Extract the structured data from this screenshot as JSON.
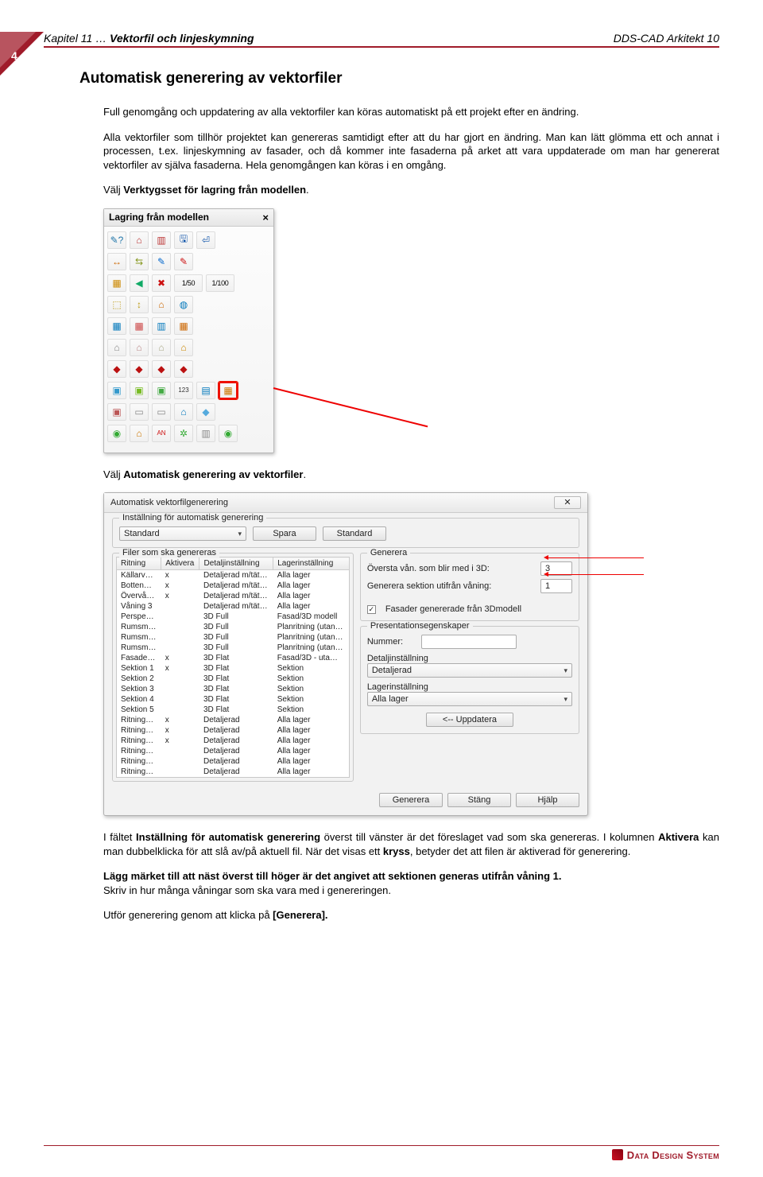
{
  "page_number": "4",
  "header": {
    "chapter_prefix": "Kapitel 11 …",
    "chapter_title": "Vektorfil och linjeskymning",
    "product": "DDS-CAD Arkitekt 10"
  },
  "heading": "Automatisk generering av vektorfiler",
  "para1": "Full genomgång och uppdatering av alla vektorfiler kan köras automatiskt på ett projekt efter en ändring.",
  "para2": "Alla vektorfiler som tillhör projektet kan genereras samtidigt efter att du har gjort en ändring. Man kan lätt glömma ett och annat i processen, t.ex. linjeskymning av fasader, och då kommer inte fasaderna på arket att vara uppdaterade om man har genererat vektorfiler av själva fasaderna. Hela genomgången kan köras i en omgång.",
  "para3_a": "Välj ",
  "para3_b": "Verktygsset för lagring från modellen",
  "para3_c": ".",
  "palette": {
    "title": "Lagring från modellen",
    "scale_a": "1/50",
    "scale_b": "1/100"
  },
  "para4_a": "Välj ",
  "para4_b": "Automatisk generering av vektorfiler",
  "para4_c": ".",
  "dialog": {
    "title": "Automatisk vektorfilgenerering",
    "group1_legend": "Inställning för automatisk generering",
    "preset": "Standard",
    "btn_save": "Spara",
    "btn_standard": "Standard",
    "group2_legend": "Filer som ska genereras",
    "cols": {
      "c1": "Ritning",
      "c2": "Aktivera",
      "c3": "Detaljinställning",
      "c4": "Lagerinställning"
    },
    "rows": [
      {
        "r": "Källarv…",
        "a": "x",
        "d": "Detaljerad m/tät…",
        "l": "Alla lager"
      },
      {
        "r": "Botten…",
        "a": "x",
        "d": "Detaljerad m/tät…",
        "l": "Alla lager"
      },
      {
        "r": "Övervå…",
        "a": "x",
        "d": "Detaljerad m/tät…",
        "l": "Alla lager"
      },
      {
        "r": "Våning 3",
        "a": "",
        "d": "Detaljerad m/tät…",
        "l": "Alla lager"
      },
      {
        "r": "Perspe…",
        "a": "",
        "d": "3D Full",
        "l": "Fasad/3D modell"
      },
      {
        "r": "Rumsm…",
        "a": "",
        "d": "3D Full",
        "l": "Planritning (utan…"
      },
      {
        "r": "Rumsm…",
        "a": "",
        "d": "3D Full",
        "l": "Planritning (utan…"
      },
      {
        "r": "Rumsm…",
        "a": "",
        "d": "3D Full",
        "l": "Planritning (utan…"
      },
      {
        "r": "Fasade…",
        "a": "x",
        "d": "3D Flat",
        "l": "Fasad/3D - uta…"
      },
      {
        "r": "Sektion 1",
        "a": "x",
        "d": "3D Flat",
        "l": "Sektion"
      },
      {
        "r": "Sektion 2",
        "a": "",
        "d": "3D Flat",
        "l": "Sektion"
      },
      {
        "r": "Sektion 3",
        "a": "",
        "d": "3D Flat",
        "l": "Sektion"
      },
      {
        "r": "Sektion 4",
        "a": "",
        "d": "3D Flat",
        "l": "Sektion"
      },
      {
        "r": "Sektion 5",
        "a": "",
        "d": "3D Flat",
        "l": "Sektion"
      },
      {
        "r": "Ritning…",
        "a": "x",
        "d": "Detaljerad",
        "l": "Alla lager"
      },
      {
        "r": "Ritning…",
        "a": "x",
        "d": "Detaljerad",
        "l": "Alla lager"
      },
      {
        "r": "Ritning…",
        "a": "x",
        "d": "Detaljerad",
        "l": "Alla lager"
      },
      {
        "r": "Ritning…",
        "a": "",
        "d": "Detaljerad",
        "l": "Alla lager"
      },
      {
        "r": "Ritning…",
        "a": "",
        "d": "Detaljerad",
        "l": "Alla lager"
      },
      {
        "r": "Ritning…",
        "a": "",
        "d": "Detaljerad",
        "l": "Alla lager"
      }
    ],
    "gen_legend": "Generera",
    "top_floor_label": "Översta vån. som blir med i 3D:",
    "top_floor_value": "3",
    "section_label": "Generera sektion utifrån våning:",
    "section_value": "1",
    "fasader_chk": "Fasader genererade från 3Dmodell",
    "pres_legend": "Presentationsegenskaper",
    "nummer_label": "Nummer:",
    "detalj_label": "Detaljinställning",
    "detalj_value": "Detaljerad",
    "lager_label": "Lagerinställning",
    "lager_value": "Alla lager",
    "btn_update": "<-- Uppdatera",
    "btn_generate": "Generera",
    "btn_close": "Stäng",
    "btn_help": "Hjälp"
  },
  "para5_a": "I fältet ",
  "para5_b": "Inställning för automatisk generering",
  "para5_c": " överst till vänster är det föreslaget vad som ska genereras. I kolumnen ",
  "para5_d": "Aktivera",
  "para5_e": " kan man dubbelklicka för att slå av/på aktuell fil. När det visas ett ",
  "para5_f": "kryss",
  "para5_g": ", betyder det att filen är aktiverad för generering.",
  "para6_a": "Lägg märket till att näst överst till höger är det angivet att sektionen generas utifrån våning 1.",
  "para6_b": "Skriv in hur många våningar som ska vara med i genereringen.",
  "para7_a": "Utför generering genom att klicka på ",
  "para7_b": "[Generera].",
  "footer_brand": "Data Design System"
}
